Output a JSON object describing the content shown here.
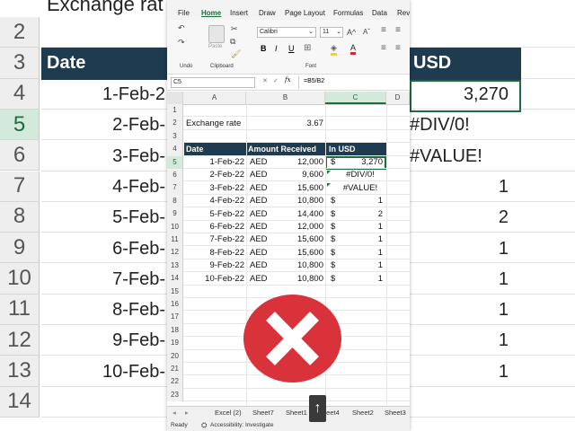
{
  "background": {
    "top_title": "Exchange rat",
    "row_numbers": [
      "2",
      "3",
      "4",
      "5",
      "6",
      "7",
      "8",
      "9",
      "10",
      "11",
      "12",
      "13",
      "14"
    ],
    "header_date": "Date",
    "header_usd": "USD",
    "dates": [
      "1-Feb-2",
      "2-Feb-",
      "3-Feb-",
      "4-Feb-",
      "5-Feb-",
      "6-Feb-",
      "7-Feb-",
      "8-Feb-",
      "9-Feb-",
      "10-Feb-"
    ],
    "usd_values": [
      "3,270",
      "#DIV/0!",
      "#VALUE!",
      "1",
      "2",
      "1",
      "1",
      "1",
      "1",
      "1"
    ]
  },
  "excel": {
    "menu": [
      "File",
      "Home",
      "Insert",
      "Draw",
      "Page Layout",
      "Formulas",
      "Data",
      "Rev"
    ],
    "active_menu": "Home",
    "ribbon": {
      "undo_group": "Undo",
      "clipboard_group": "Clipboard",
      "font_group": "Font",
      "paste_label": "Paste",
      "font_name": "Calibri",
      "font_size": "11",
      "bold": "B",
      "italic": "I",
      "underline": "U"
    },
    "name_box": "C5",
    "formula": "=B5/B2",
    "fx": "fx",
    "columns": [
      "A",
      "B",
      "C",
      "D"
    ],
    "rows": [
      "1",
      "2",
      "3",
      "4",
      "5",
      "6",
      "7",
      "8",
      "9",
      "10",
      "11",
      "12",
      "13",
      "14",
      "15",
      "16",
      "17",
      "18",
      "19",
      "20",
      "21",
      "22",
      "23"
    ],
    "selected_row": "5",
    "selected_col": "C",
    "exchange_label": "Exchange rate",
    "exchange_value": "3.67",
    "table_headers": [
      "Date",
      "Amount Received",
      "In USD"
    ],
    "table": [
      {
        "date": "1-Feb-22",
        "cur": "AED",
        "amt": "12,000",
        "usd_sym": "$",
        "usd": "3,270"
      },
      {
        "date": "2-Feb-22",
        "cur": "AED",
        "amt": "9,600",
        "usd_sym": "",
        "usd": "#DIV/0!"
      },
      {
        "date": "3-Feb-22",
        "cur": "AED",
        "amt": "15,600",
        "usd_sym": "",
        "usd": "#VALUE!"
      },
      {
        "date": "4-Feb-22",
        "cur": "AED",
        "amt": "10,800",
        "usd_sym": "$",
        "usd": "1"
      },
      {
        "date": "5-Feb-22",
        "cur": "AED",
        "amt": "14,400",
        "usd_sym": "$",
        "usd": "2"
      },
      {
        "date": "6-Feb-22",
        "cur": "AED",
        "amt": "12,000",
        "usd_sym": "$",
        "usd": "1"
      },
      {
        "date": "7-Feb-22",
        "cur": "AED",
        "amt": "15,600",
        "usd_sym": "$",
        "usd": "1"
      },
      {
        "date": "8-Feb-22",
        "cur": "AED",
        "amt": "15,600",
        "usd_sym": "$",
        "usd": "1"
      },
      {
        "date": "9-Feb-22",
        "cur": "AED",
        "amt": "10,800",
        "usd_sym": "$",
        "usd": "1"
      },
      {
        "date": "10-Feb-22",
        "cur": "AED",
        "amt": "10,800",
        "usd_sym": "$",
        "usd": "1"
      }
    ],
    "sheet_tabs": [
      "Excel (2)",
      "Sheet7",
      "Sheet1",
      "Sheet4",
      "Sheet2",
      "Sheet3"
    ],
    "status_ready": "Ready",
    "status_accessibility": "Accessibility: Investigate",
    "up_arrow": "↑"
  },
  "colors": {
    "header_fill": "#1f3b50",
    "selection_green": "#1e6b3c",
    "error_red": "#d9323a"
  }
}
